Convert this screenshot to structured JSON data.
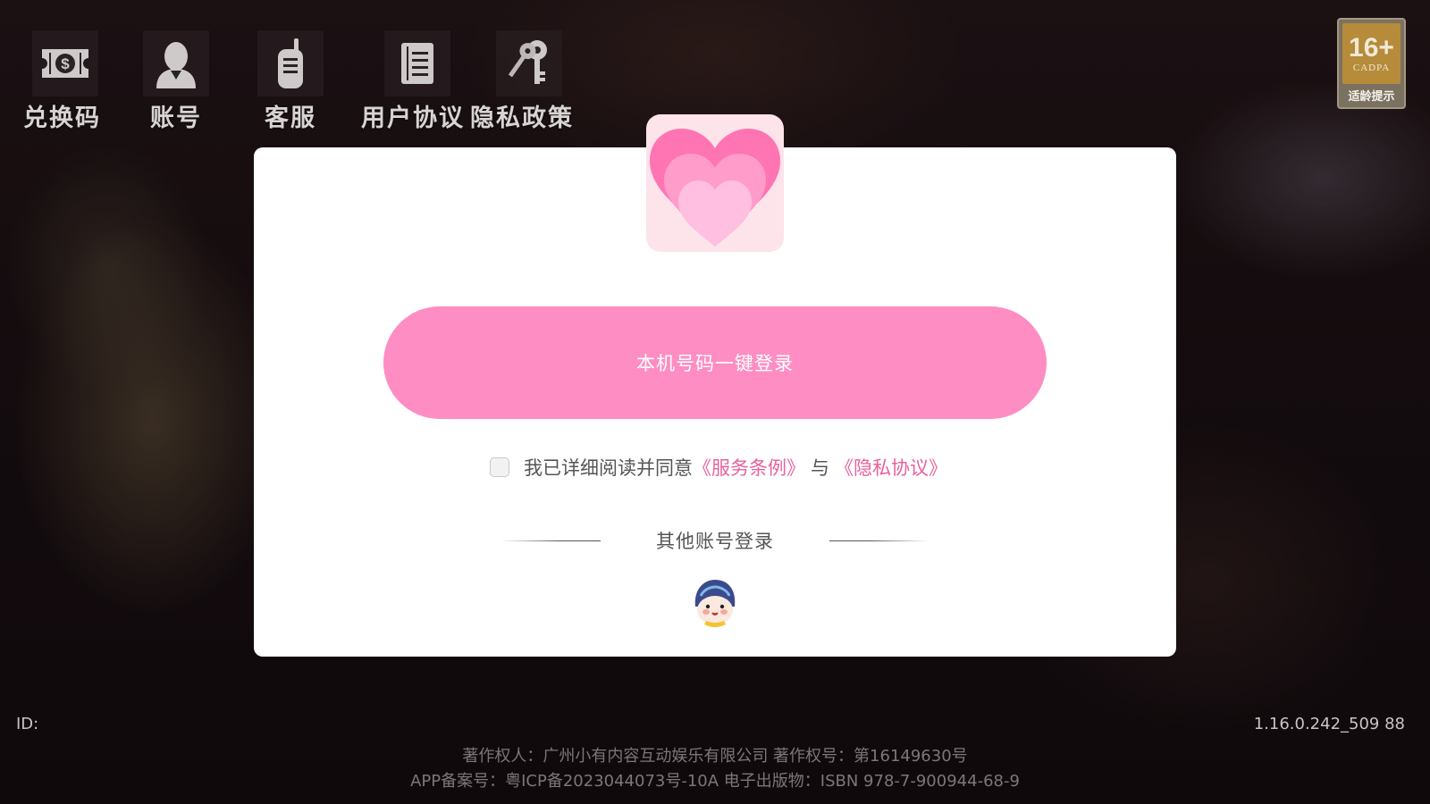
{
  "toolbar": {
    "items": [
      {
        "label": "兑换码",
        "icon": "ticket-dollar-icon"
      },
      {
        "label": "账号",
        "icon": "user-avatar-icon"
      },
      {
        "label": "客服",
        "icon": "walkie-talkie-icon"
      },
      {
        "label": "用户协议",
        "icon": "document-list-icon"
      },
      {
        "label": "隐私政策",
        "icon": "keys-icon"
      }
    ]
  },
  "age_rating": {
    "value": "16+",
    "org": "CADPA",
    "tip": "适龄提示",
    "color": "#b68b3a"
  },
  "dialog": {
    "logo_icon": "pink-heart-icon",
    "login_button": "本机号码一键登录",
    "agree_text": "我已详细阅读并同意",
    "terms_link": "《服务条例》",
    "and_text": "与",
    "privacy_link": "《隐私协议》",
    "other_login": "其他账号登录",
    "alt_login_icon": "mascot-avatar-icon",
    "accent_color": "#fd8dc2",
    "link_color": "#e8619f"
  },
  "footer": {
    "id_label": "ID:",
    "version": "1.16.0.242_509 88",
    "copyright_line": "著作权人：广州小有内容互动娱乐有限公司    著作权号：第16149630号",
    "license_line": "APP备案号：粤ICP备2023044073号-10A 电子出版物：ISBN 978-7-900944-68-9"
  }
}
